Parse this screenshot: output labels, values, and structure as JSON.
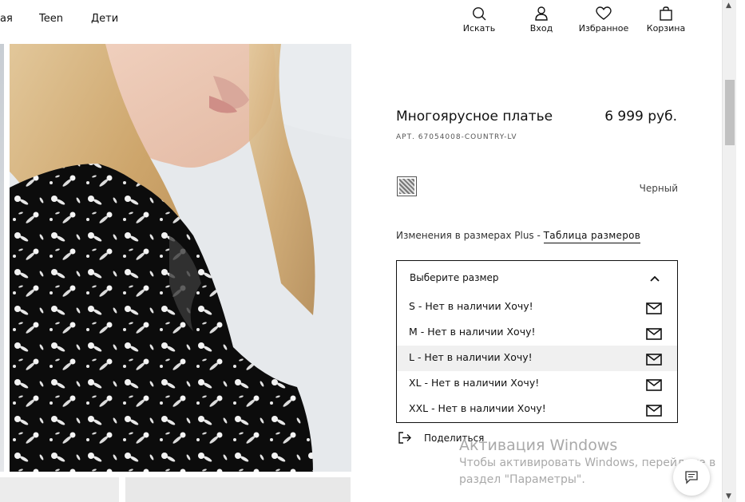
{
  "header": {
    "nav": [
      "ая",
      "Teen",
      "Дети"
    ],
    "actions": {
      "search": "Искать",
      "login": "Вход",
      "favorites": "Избранное",
      "cart": "Корзина"
    }
  },
  "product": {
    "title": "Многоярусное платье",
    "price": "6 999 руб.",
    "sku": "АРТ. 67054008-COUNTRY-LV",
    "color": "Черный",
    "size_info_text": "Изменения в размерах Plus - ",
    "size_chart_link": "Таблица размеров",
    "size_select": {
      "placeholder": "Выберите размер",
      "options": [
        "S - Нет в наличии Хочу!",
        "M - Нет в наличии Хочу!",
        "L - Нет в наличии Хочу!",
        "XL - Нет в наличии Хочу!",
        "XXL - Нет в наличии Хочу!"
      ],
      "highlighted_index": 2
    },
    "share_label": "Поделиться"
  },
  "windows_watermark": {
    "title": "Активация Windows",
    "line1": "Чтобы активировать Windows, перейдите в",
    "line2": "раздел \"Параметры\"."
  },
  "colors": {
    "text": "#111111",
    "border": "#111111",
    "highlight_row": "#f0f0f0",
    "watermark": "#a9a9a9"
  }
}
